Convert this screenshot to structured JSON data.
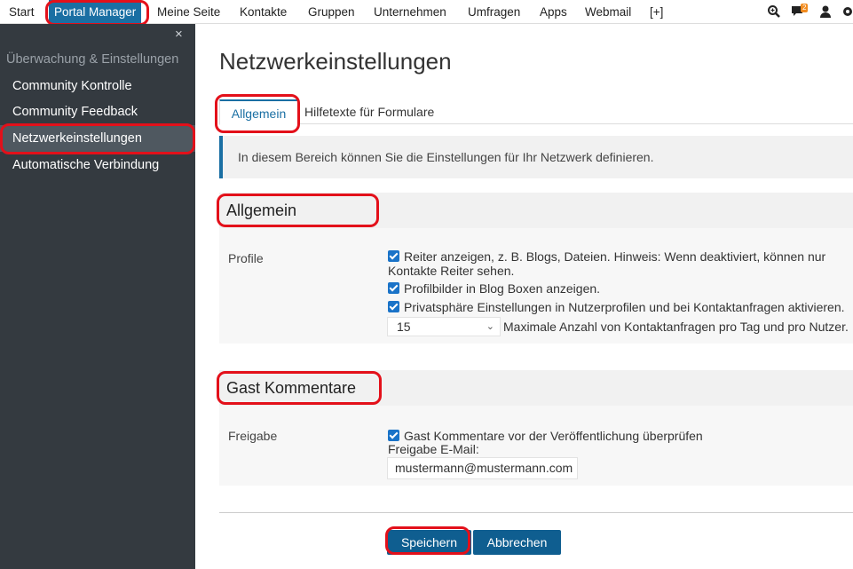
{
  "nav": {
    "items": [
      "Start",
      "Portal Manager",
      "Meine Seite",
      "Kontakte",
      "Gruppen",
      "Unternehmen",
      "Umfragen",
      "Apps",
      "Webmail",
      "[+]"
    ],
    "active": "Portal Manager",
    "notification_count": "2",
    "icons": [
      "search-icon",
      "chat-icon",
      "user-icon",
      "settings-icon"
    ]
  },
  "sidebar": {
    "close_glyph": "×",
    "section": "Überwachung & Einstellungen",
    "items": [
      {
        "label": "Community Kontrolle"
      },
      {
        "label": "Community Feedback"
      },
      {
        "label": "Netzwerkeinstellungen"
      },
      {
        "label": "Automatische Verbindung"
      }
    ]
  },
  "main": {
    "title": "Netzwerkeinstellungen",
    "tabs": [
      {
        "label": "Allgemein"
      },
      {
        "label": "Hilfetexte für Formulare"
      }
    ],
    "info": "In diesem Bereich können Sie die Einstellungen für Ihr Netzwerk definieren.",
    "sections": [
      {
        "title": "Allgemein",
        "label": "Profile",
        "options": [
          {
            "text": "Reiter anzeigen, z. B. Blogs, Dateien. Hinweis: Wenn deaktiviert, können nur Kontakte Reiter sehen.",
            "checked": true
          },
          {
            "text": "Profilbilder in Blog Boxen anzeigen.",
            "checked": true
          },
          {
            "text": "Privatsphäre Einstellungen in Nutzerprofilen und bei Kontaktanfragen aktivieren.",
            "checked": true
          }
        ],
        "select_value": "15",
        "select_label": "Maximale Anzahl von Kontaktanfragen pro Tag und pro Nutzer."
      },
      {
        "title": "Gast Kommentare",
        "label": "Freigabe",
        "option": {
          "text": "Gast Kommentare vor der Veröffentlichung überprüfen",
          "checked": true
        },
        "email_label": "Freigabe E-Mail:",
        "email_value": "mustermann@mustermann.com"
      }
    ],
    "buttons": {
      "save": "Speichern",
      "cancel": "Abbrechen"
    }
  },
  "colors": {
    "accent": "#1a6fa3",
    "annotation": "#e3101a",
    "sidebar_bg": "#343a40",
    "badge": "#f28c1f"
  }
}
